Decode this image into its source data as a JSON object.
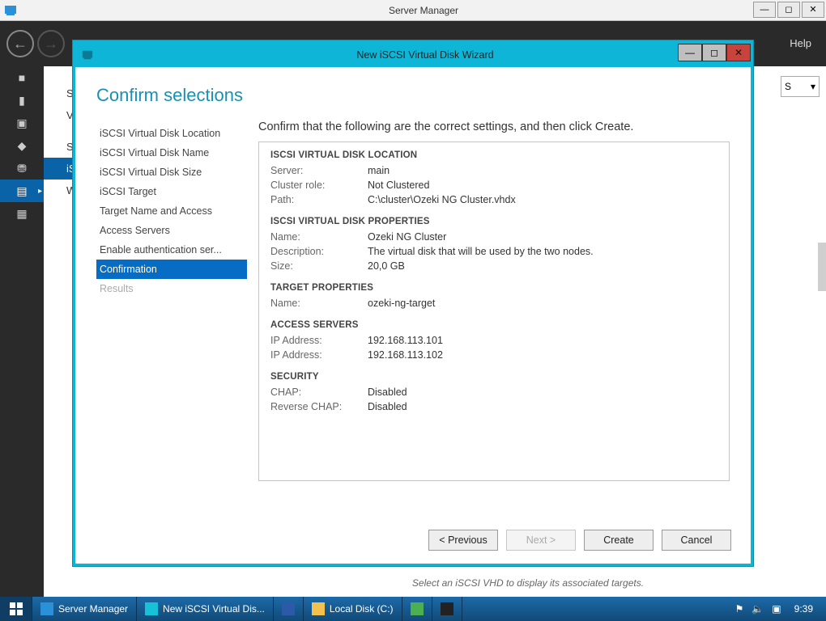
{
  "app": {
    "title": "Server Manager",
    "help": "Help"
  },
  "left_rail": {
    "items": [
      "■",
      "▮",
      "▣",
      "◆",
      "⛃",
      "▤",
      "▦"
    ],
    "selected_index": 5
  },
  "side_list": {
    "rows": [
      "Se",
      "Vo",
      "",
      "Sh",
      "iS",
      "W"
    ],
    "selected_index": 4
  },
  "dropdown_frag": {
    "label": "S",
    "arrow": "▾"
  },
  "hint": "Select an iSCSI VHD to display its associated targets.",
  "wizard": {
    "title": "New iSCSI Virtual Disk Wizard",
    "heading": "Confirm selections",
    "instruction": "Confirm that the following are the correct settings, and then click Create.",
    "steps": [
      {
        "label": "iSCSI Virtual Disk Location",
        "sel": false,
        "disabled": false
      },
      {
        "label": "iSCSI Virtual Disk Name",
        "sel": false,
        "disabled": false
      },
      {
        "label": "iSCSI Virtual Disk Size",
        "sel": false,
        "disabled": false
      },
      {
        "label": "iSCSI Target",
        "sel": false,
        "disabled": false
      },
      {
        "label": "Target Name and Access",
        "sel": false,
        "disabled": false
      },
      {
        "label": "Access Servers",
        "sel": false,
        "disabled": false
      },
      {
        "label": "Enable authentication ser...",
        "sel": false,
        "disabled": false
      },
      {
        "label": "Confirmation",
        "sel": true,
        "disabled": false
      },
      {
        "label": "Results",
        "sel": false,
        "disabled": true
      }
    ],
    "sections": [
      {
        "title": "ISCSI VIRTUAL DISK LOCATION",
        "rows": [
          {
            "k": "Server:",
            "v": "main"
          },
          {
            "k": "Cluster role:",
            "v": "Not Clustered"
          },
          {
            "k": "Path:",
            "v": "C:\\cluster\\Ozeki NG Cluster.vhdx"
          }
        ]
      },
      {
        "title": "ISCSI VIRTUAL DISK PROPERTIES",
        "rows": [
          {
            "k": "Name:",
            "v": "Ozeki NG Cluster"
          },
          {
            "k": "Description:",
            "v": "The virtual disk that will be used by the two nodes."
          },
          {
            "k": "Size:",
            "v": "20,0 GB"
          }
        ]
      },
      {
        "title": "TARGET PROPERTIES",
        "rows": [
          {
            "k": "Name:",
            "v": "ozeki-ng-target"
          }
        ]
      },
      {
        "title": "ACCESS SERVERS",
        "rows": [
          {
            "k": "IP Address:",
            "v": "192.168.113.101"
          },
          {
            "k": "IP Address:",
            "v": "192.168.113.102"
          }
        ]
      },
      {
        "title": "SECURITY",
        "rows": [
          {
            "k": "CHAP:",
            "v": "Disabled"
          },
          {
            "k": "Reverse CHAP:",
            "v": "Disabled"
          }
        ]
      }
    ],
    "buttons": {
      "previous": "< Previous",
      "next": "Next >",
      "create": "Create",
      "cancel": "Cancel"
    }
  },
  "taskbar": {
    "tasks": [
      {
        "label": "Server Manager"
      },
      {
        "label": "New iSCSI Virtual Dis..."
      },
      {
        "label": ""
      },
      {
        "label": "Local Disk (C:)"
      },
      {
        "label": ""
      },
      {
        "label": ""
      }
    ],
    "clock": "9:39",
    "tray": [
      "⚑",
      "🔈",
      "▣"
    ]
  }
}
